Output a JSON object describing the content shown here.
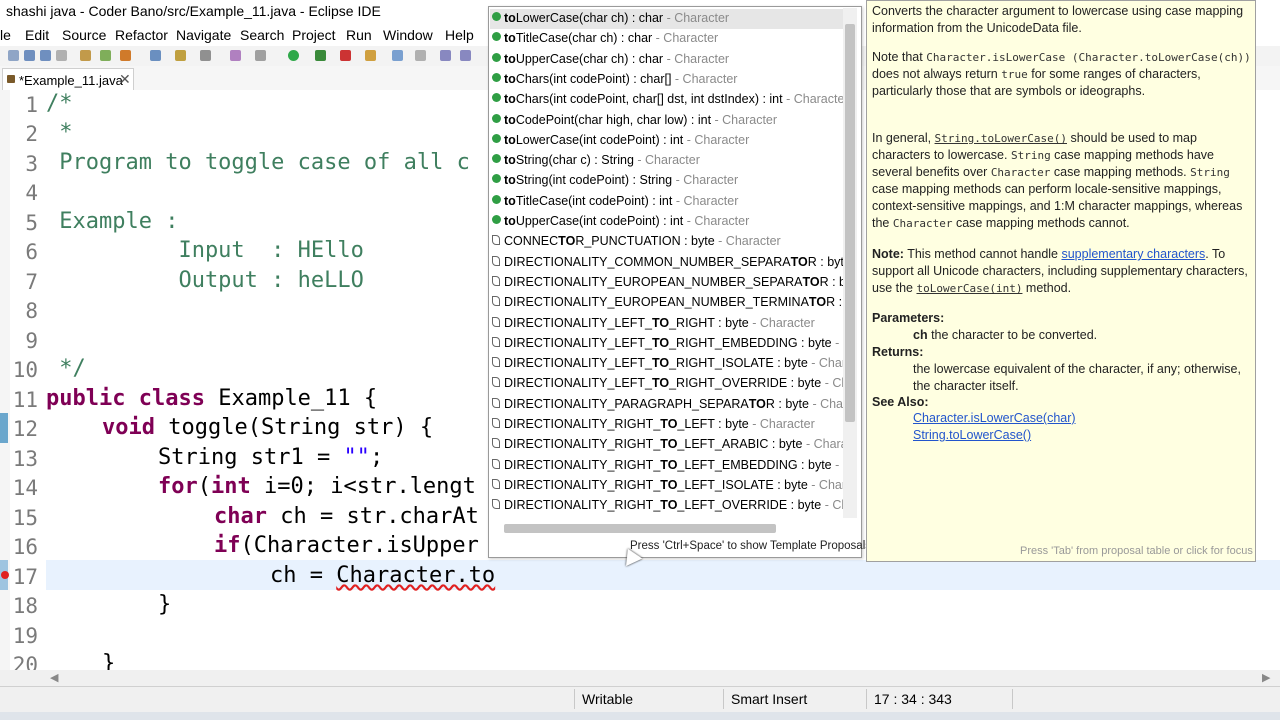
{
  "window": {
    "title": "shashi java - Coder Bano/src/Example_11.java - Eclipse IDE"
  },
  "menu": [
    "le",
    "Edit",
    "Source",
    "Refactor",
    "Navigate",
    "Search",
    "Project",
    "Run",
    "Window",
    "Help"
  ],
  "tab": {
    "label": "*Example_11.java",
    "close": "✕"
  },
  "editor": {
    "line_numbers": [
      "1",
      "2",
      "3",
      "4",
      "5",
      "6",
      "7",
      "8",
      "9",
      "10",
      "11",
      "12",
      "13",
      "14",
      "15",
      "16",
      "17",
      "18",
      "19",
      "20"
    ],
    "lines": {
      "l1": "/*",
      "l2": " *",
      "l3": " Program to toggle case of all c",
      "l5": " Example :",
      "l6": "          Input  : HEllo",
      "l7": "          Output : heLLO",
      "l10": " */",
      "l11_kw1": "public",
      "l11_kw2": "class",
      "l11_rest": " Example_11 {",
      "l12_kw": "void",
      "l12_rest": " toggle(String str) {",
      "l13_a": "String str1 = ",
      "l13_str": "\"\"",
      "l13_b": ";",
      "l14_kw1": "for",
      "l14_mid": "(",
      "l14_kw2": "int",
      "l14_rest": " i=0; i<str.lengt",
      "l15_kw": "char",
      "l15_rest": " ch = str.charAt",
      "l16_kw": "if",
      "l16_rest": "(Character.isUpper",
      "l17_a": "ch = ",
      "l17_sq": "Character.to",
      "l18": "}",
      "l20": "}"
    }
  },
  "proposals": [
    {
      "bold": "to",
      "rest": "LowerCase(char ch) : char",
      "type": " - Character",
      "static": false
    },
    {
      "bold": "to",
      "rest": "TitleCase(char ch) : char",
      "type": " - Character",
      "static": false
    },
    {
      "bold": "to",
      "rest": "UpperCase(char ch) : char",
      "type": " - Character",
      "static": false
    },
    {
      "bold": "to",
      "rest": "Chars(int codePoint) : char[]",
      "type": " - Character",
      "static": false
    },
    {
      "bold": "to",
      "rest": "Chars(int codePoint, char[] dst, int dstIndex) : int",
      "type": " - Character",
      "static": false
    },
    {
      "bold": "to",
      "rest": "CodePoint(char high, char low) : int",
      "type": " - Character",
      "static": false
    },
    {
      "bold": "to",
      "rest": "LowerCase(int codePoint) : int",
      "type": " - Character",
      "static": false
    },
    {
      "bold": "to",
      "rest": "String(char c) : String",
      "type": " - Character",
      "static": false
    },
    {
      "bold": "to",
      "rest": "String(int codePoint) : String",
      "type": " - Character",
      "static": false
    },
    {
      "bold": "to",
      "rest": "TitleCase(int codePoint) : int",
      "type": " - Character",
      "static": false
    },
    {
      "bold": "to",
      "rest": "UpperCase(int codePoint) : int",
      "type": " - Character",
      "static": false
    },
    {
      "pre": "CONNEC",
      "bold": "TO",
      "rest": "R_PUNCTUATION : byte",
      "type": " - Character",
      "static": true
    },
    {
      "pre": "DIRECTIONALITY_COMMON_NUMBER_SEPARA",
      "bold": "TO",
      "rest": "R : byte",
      "type": " - C",
      "static": true
    },
    {
      "pre": "DIRECTIONALITY_EUROPEAN_NUMBER_SEPARA",
      "bold": "TO",
      "rest": "R : byte",
      "type": " - C",
      "static": true
    },
    {
      "pre": "DIRECTIONALITY_EUROPEAN_NUMBER_TERMINA",
      "bold": "TO",
      "rest": "R : byte",
      "type": " - C",
      "static": true
    },
    {
      "pre": "DIRECTIONALITY_LEFT_",
      "bold": "TO",
      "rest": "_RIGHT : byte",
      "type": " - Character",
      "static": true
    },
    {
      "pre": "DIRECTIONALITY_LEFT_",
      "bold": "TO",
      "rest": "_RIGHT_EMBEDDING : byte",
      "type": " - Chara",
      "static": true
    },
    {
      "pre": "DIRECTIONALITY_LEFT_",
      "bold": "TO",
      "rest": "_RIGHT_ISOLATE : byte",
      "type": " - Character",
      "static": true
    },
    {
      "pre": "DIRECTIONALITY_LEFT_",
      "bold": "TO",
      "rest": "_RIGHT_OVERRIDE : byte",
      "type": " - Characte",
      "static": true
    },
    {
      "pre": "DIRECTIONALITY_PARAGRAPH_SEPARA",
      "bold": "TO",
      "rest": "R : byte",
      "type": " - Characte",
      "static": true
    },
    {
      "pre": "DIRECTIONALITY_RIGHT_",
      "bold": "TO",
      "rest": "_LEFT : byte",
      "type": " - Character",
      "static": true
    },
    {
      "pre": "DIRECTIONALITY_RIGHT_",
      "bold": "TO",
      "rest": "_LEFT_ARABIC : byte",
      "type": " - Character",
      "static": true
    },
    {
      "pre": "DIRECTIONALITY_RIGHT_",
      "bold": "TO",
      "rest": "_LEFT_EMBEDDING : byte",
      "type": " - Chara",
      "static": true
    },
    {
      "pre": "DIRECTIONALITY_RIGHT_",
      "bold": "TO",
      "rest": "_LEFT_ISOLATE : byte",
      "type": " - Character",
      "static": true
    },
    {
      "pre": "DIRECTIONALITY_RIGHT_",
      "bold": "TO",
      "rest": "_LEFT_OVERRIDE : byte",
      "type": " - Characte",
      "static": true
    }
  ],
  "popup_footer": "Press 'Ctrl+Space' to show Template Proposals",
  "doc": {
    "p1": "Converts the character argument to lowercase using case mapping information from the UnicodeData file.",
    "p2_a": "Note that ",
    "p2_code1": "Character.isLowerCase (Character.toLowerCase(ch))",
    "p2_b": " does not always return ",
    "p2_code2": "true",
    "p2_c": " for some ranges of characters, particularly those that are symbols or ideographs.",
    "p3_a": "In general, ",
    "p3_link": "String.toLowerCase()",
    "p3_b": " should be used to map characters to lowercase. ",
    "p3_code1": "String",
    "p3_c": " case mapping methods have several benefits over ",
    "p3_code2": "Character",
    "p3_d": " case mapping methods. ",
    "p3_code3": "String",
    "p3_e": " case mapping methods can perform locale-sensitive mappings, context-sensitive mappings, and 1:M character mappings, whereas the ",
    "p3_code4": "Character",
    "p3_f": " case mapping methods cannot.",
    "p4_bold": "Note:",
    "p4_a": " This method cannot handle ",
    "p4_link": "supplementary characters",
    "p4_b": ". To support all Unicode characters, including supplementary characters, use the ",
    "p4_code": "toLowerCase(int)",
    "p4_c": " method.",
    "params_label": "Parameters:",
    "param_name": "ch",
    "param_desc": " the character to be converted.",
    "returns_label": "Returns:",
    "returns_desc": "the lowercase equivalent of the character, if any; otherwise, the character itself.",
    "seealso_label": "See Also:",
    "seealso_1": "Character.isLowerCase(char)",
    "seealso_2": "String.toLowerCase()",
    "footer": "Press 'Tab' from proposal table or click for focus"
  },
  "status": {
    "writable": "Writable",
    "insert": "Smart Insert",
    "position": "17 : 34 : 343"
  }
}
